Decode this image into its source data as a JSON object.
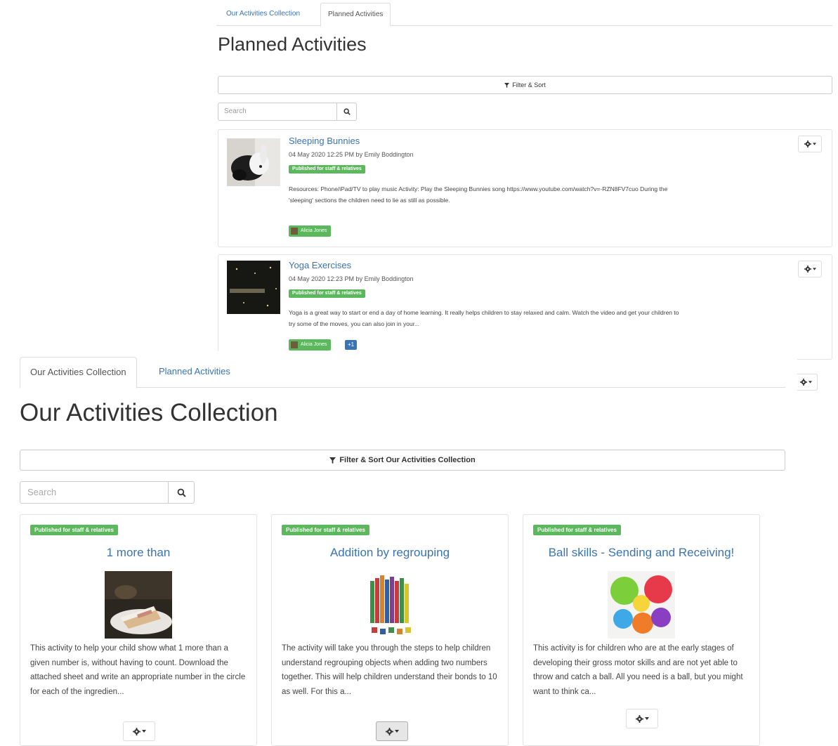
{
  "colors": {
    "link": "#3a74b3",
    "status_green": "#5cb85c",
    "border": "#dddddd",
    "count_badge": "#3a74b3"
  },
  "planned": {
    "tabs": [
      {
        "label": "Our Activities Collection",
        "active": false
      },
      {
        "label": "Planned Activities",
        "active": true
      }
    ],
    "title": "Planned Activities",
    "filter_label": "Filter & Sort",
    "search_placeholder": "Search",
    "items": [
      {
        "title": "Sleeping Bunnies",
        "meta": "04 May 2020 12:25 PM by Emily Boddington",
        "status": "Published for staff & relatives",
        "description": "Resources: Phone/iPad/TV to play music Activity: Play the Sleeping Bunnies song https://www.youtube.com/watch?v=-RZN8FV7cuo During the 'sleeping' sections the children need to lie as still as possible.",
        "child": "Alicia Jones"
      },
      {
        "title": "Yoga Exercises",
        "meta": "04 May 2020 12:23 PM by Emily Boddington",
        "status": "Published for staff & relatives",
        "description": "Yoga is a great way to start or end a day of home learning. It really helps children to stay relaxed and calm. Watch the video and get your children to try some of the moves, you can also join in your...",
        "child": "Alicia Jones",
        "count": "+1"
      }
    ]
  },
  "collection": {
    "tabs": [
      {
        "label": "Our Activities Collection",
        "active": true
      },
      {
        "label": "Planned Activities",
        "active": false
      }
    ],
    "title": "Our Activities Collection",
    "filter_label": "Filter & Sort Our Activities Collection",
    "search_placeholder": "Search",
    "cards": [
      {
        "status": "Published for staff & relatives",
        "title": "1 more than",
        "image": "cake-slice-photo",
        "description": "This activity to help your child show what 1 more than a given number is, without having to count. Download the attached sheet and write an appropriate number in the circle for each of the ingredien..."
      },
      {
        "status": "Published for staff & relatives",
        "title": "Addition by regrouping",
        "image": "number-rods-photo",
        "description": "The activity will take you through the steps to help children understand regrouping objects when adding two numbers together. This will help children understand their bonds to 10 as well. For this a..."
      },
      {
        "status": "Published for staff & relatives",
        "title": "Ball skills - Sending and Receiving!",
        "image": "colourful-balls-photo",
        "description": "This activity is for children who are at the early stages of developing their gross motor skills and are not yet able to throw and catch a ball. All you need is a ball, but you might want to think ca..."
      }
    ]
  }
}
